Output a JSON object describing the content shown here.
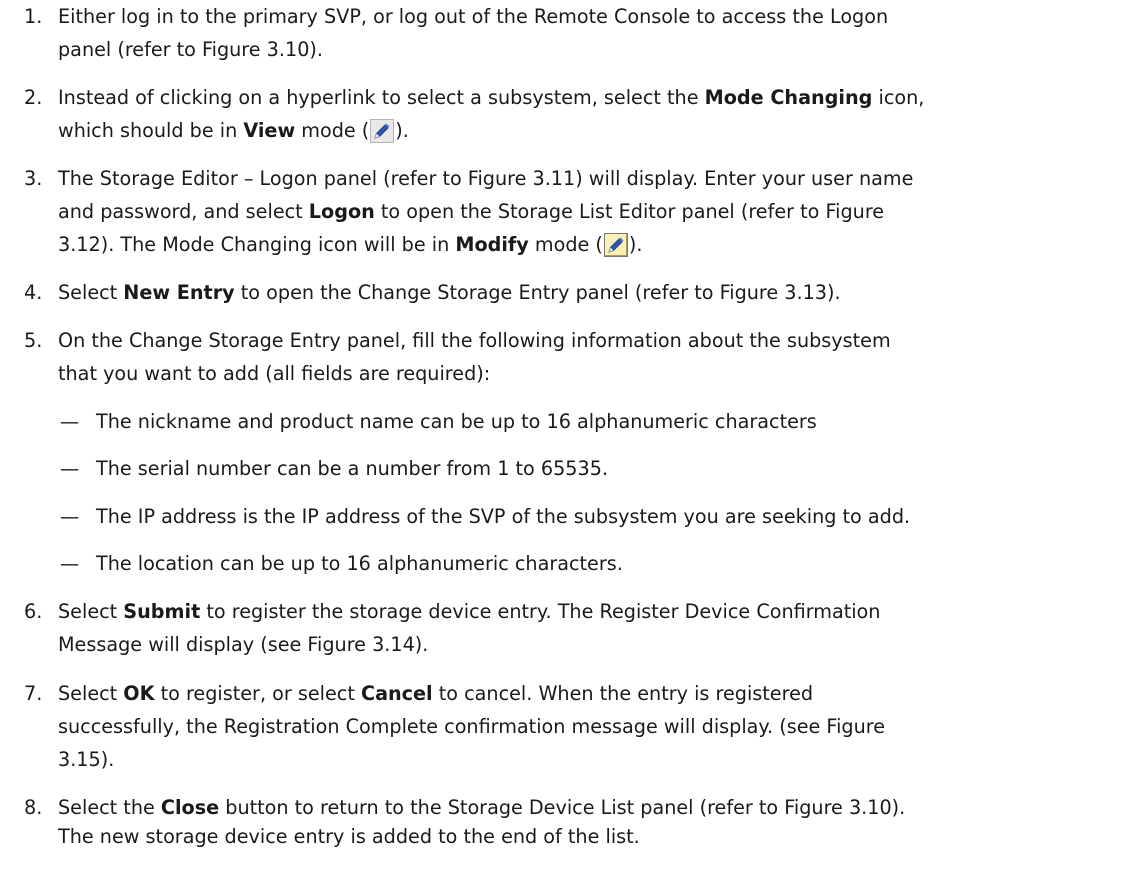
{
  "steps": [
    {
      "number": "1.",
      "line1": "Either log in to the primary SVP, or log out of the Remote Console to access the Logon",
      "line2": "panel (refer to Figure 3.10)."
    },
    {
      "number": "2.",
      "l1_a": "Instead of clicking on a hyperlink to select a subsystem, select the ",
      "l1_b": "Mode Changing",
      "l1_c": " icon,",
      "l2_a": "which should be in ",
      "l2_b": "View",
      "l2_c": " mode (",
      "l2_d": ")."
    },
    {
      "number": "3.",
      "line1": "The Storage Editor – Logon panel (refer to Figure 3.11) will display. Enter your user name",
      "l2_a": "and password, and select ",
      "l2_b": "Logon",
      "l2_c": " to open the Storage List Editor panel (refer to Figure",
      "l3_a": "3.12). The Mode Changing icon will be in ",
      "l3_b": "Modify",
      "l3_c": " mode (",
      "l3_d": ")."
    },
    {
      "number": "4.",
      "l1_a": "Select ",
      "l1_b": "New Entry",
      "l1_c": " to open the Change Storage Entry panel (refer to Figure 3.13)."
    },
    {
      "number": "5.",
      "line1": "On the Change Storage Entry panel, fill the following information about the subsystem",
      "line2": "that you want to add (all fields are required):"
    },
    {
      "number": "6.",
      "l1_a": "Select ",
      "l1_b": "Submit",
      "l1_c": " to register the storage device entry. The Register Device Confirmation",
      "line2": "Message will display (see Figure 3.14)."
    },
    {
      "number": "7.",
      "l1_a": "Select ",
      "l1_b": "OK",
      "l1_c": " to register, or select ",
      "l1_d": "Cancel",
      "l1_e": " to cancel. When the entry is registered",
      "line2": "successfully, the Registration Complete confirmation message will display. (see Figure",
      "line3": "3.15)."
    },
    {
      "number": "8.",
      "l1_a": "Select the ",
      "l1_b": "Close",
      "l1_c": " button to return to the Storage Device List panel (refer to Figure 3.10).",
      "line2": "The new storage device entry is added to the end of the list."
    }
  ],
  "bullets": [
    {
      "dash": "—",
      "text": "The nickname and product name can be up to 16 alphanumeric characters"
    },
    {
      "dash": "—",
      "text": "The serial number can be a number from 1 to 65535."
    },
    {
      "dash": "—",
      "text": "The IP address is the IP address of the SVP of the subsystem you are seeking to add."
    },
    {
      "dash": "—",
      "text": "The location can be up to 16 alphanumeric characters."
    }
  ],
  "icons": {
    "view_mode": "mode-changing-view-icon",
    "modify_mode": "mode-changing-modify-icon",
    "colors": {
      "view_bg": "#e8e8e8",
      "modify_bg": "#fbf0b6",
      "pen_blue": "#2f56b8"
    }
  }
}
